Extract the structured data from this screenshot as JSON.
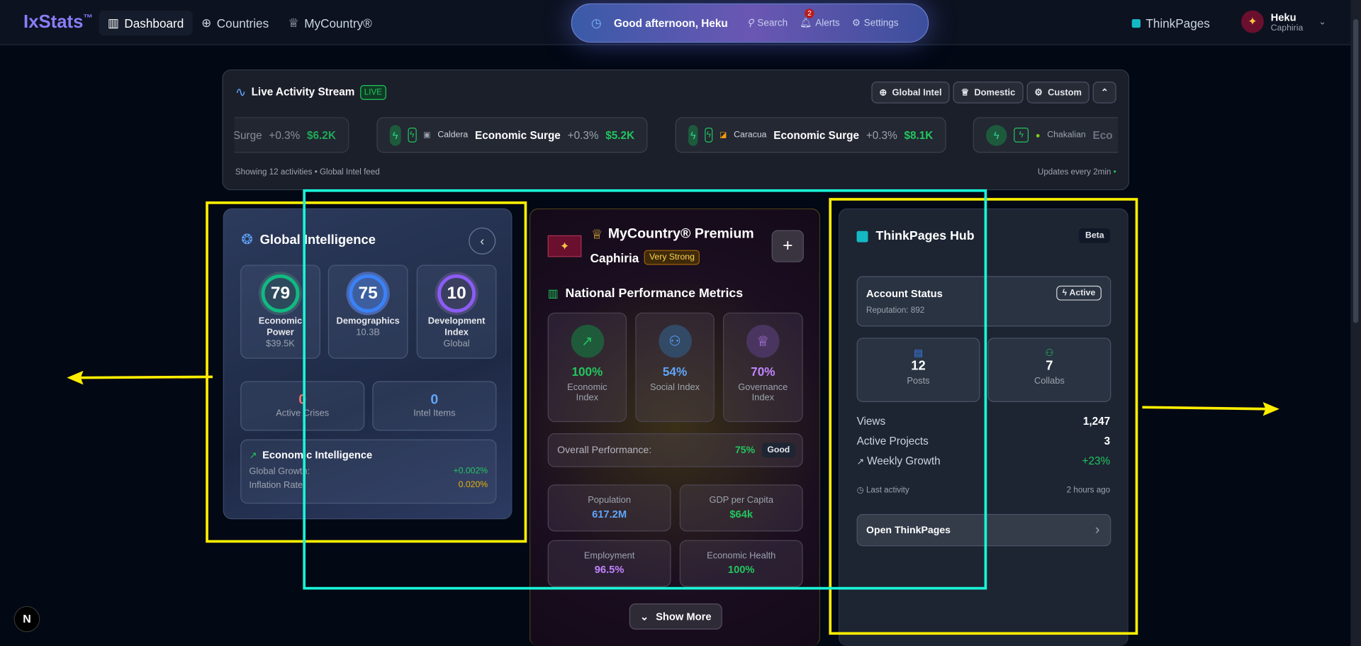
{
  "nav": {
    "logo": "IxStats",
    "logo_tm": "™",
    "items": [
      {
        "label": "Dashboard",
        "icon": "bar-chart-icon"
      },
      {
        "label": "Countries",
        "icon": "globe-icon"
      },
      {
        "label": "MyCountry®",
        "icon": "crown-icon"
      }
    ],
    "greeting": "Good afternoon, Heku",
    "search": "Search",
    "alerts": "Alerts",
    "alerts_count": "2",
    "settings": "Settings",
    "thinkpages": "ThinkPages",
    "user_name": "Heku",
    "user_country": "Caphiria"
  },
  "stream": {
    "title": "Live Activity Stream",
    "live": "LIVE",
    "filters": [
      "Global Intel",
      "Domestic",
      "Custom"
    ],
    "items": [
      {
        "country": "",
        "event": "Surge",
        "change": "+0.3%",
        "value": "$6.2K"
      },
      {
        "country": "Caldera",
        "event": "Economic Surge",
        "change": "+0.3%",
        "value": "$5.2K"
      },
      {
        "country": "Caracua",
        "event": "Economic Surge",
        "change": "+0.3%",
        "value": "$8.1K"
      },
      {
        "country": "Chakalian",
        "event": "Eco",
        "change": "",
        "value": ""
      }
    ],
    "footer_left": "Showing 12 activities • Global Intel feed",
    "footer_right": "Updates every 2min"
  },
  "global": {
    "title": "Global Intelligence",
    "scores": [
      {
        "value": "79",
        "label": "Economic Power",
        "sub": "$39.5K",
        "color": "#10b981"
      },
      {
        "value": "75",
        "label": "Demographics",
        "sub": "10.3B",
        "color": "#3b82f6"
      },
      {
        "value": "10",
        "label": "Development Index",
        "sub": "Global",
        "color": "#8b5cf6"
      }
    ],
    "crises": {
      "value": "0",
      "label": "Active Crises"
    },
    "intel": {
      "value": "0",
      "label": "Intel Items"
    },
    "econ": {
      "title": "Economic Intelligence",
      "rows": [
        {
          "label": "Global Growth:",
          "value": "+0.002%"
        },
        {
          "label": "Inflation Rate:",
          "value": "0.020%"
        }
      ]
    }
  },
  "mycountry": {
    "title": "MyCountry® Premium",
    "country": "Caphiria",
    "strength": "Very Strong",
    "metrics_title": "National Performance Metrics",
    "indices": [
      {
        "value": "100%",
        "label": "Economic Index"
      },
      {
        "value": "54%",
        "label": "Social Index"
      },
      {
        "value": "70%",
        "label": "Governance Index"
      }
    ],
    "overall_label": "Overall Performance:",
    "overall_value": "75%",
    "overall_badge": "Good",
    "stats": [
      {
        "label": "Population",
        "value": "617.2M"
      },
      {
        "label": "GDP per Capita",
        "value": "$64k"
      },
      {
        "label": "Employment",
        "value": "96.5%"
      },
      {
        "label": "Economic Health",
        "value": "100%"
      }
    ],
    "show_more": "Show More"
  },
  "thinkpages": {
    "title": "ThinkPages Hub",
    "beta": "Beta",
    "account_title": "Account Status",
    "active": "Active",
    "reputation": "Reputation: 892",
    "posts": {
      "value": "12",
      "label": "Posts"
    },
    "collabs": {
      "value": "7",
      "label": "Collabs"
    },
    "rows": [
      {
        "label": "Views",
        "value": "1,247"
      },
      {
        "label": "Active Projects",
        "value": "3"
      },
      {
        "label": "Weekly Growth",
        "value": "+23%"
      }
    ],
    "last_label": "Last activity",
    "last_value": "2 hours ago",
    "open": "Open ThinkPages"
  }
}
